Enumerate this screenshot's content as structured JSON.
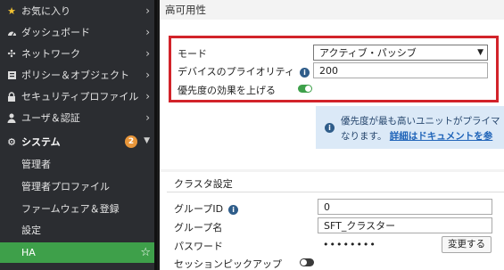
{
  "sidebar": {
    "items": [
      {
        "label": "お気に入り",
        "icon": "star-icon"
      },
      {
        "label": "ダッシュボード",
        "icon": "dashboard-icon"
      },
      {
        "label": "ネットワーク",
        "icon": "network-icon"
      },
      {
        "label": "ポリシー＆オブジェクト",
        "icon": "policy-icon"
      },
      {
        "label": "セキュリティプロファイル",
        "icon": "lock-icon"
      },
      {
        "label": "ユーザ＆認証",
        "icon": "user-icon"
      }
    ],
    "system": {
      "label": "システム",
      "badge": "2",
      "icon": "gear-icon"
    },
    "sub_items": [
      {
        "label": "管理者"
      },
      {
        "label": "管理者プロファイル"
      },
      {
        "label": "ファームウェア＆登録"
      },
      {
        "label": "設定"
      }
    ],
    "active": {
      "label": "HA"
    }
  },
  "main": {
    "section_title": "高可用性",
    "mode_label": "モード",
    "mode_value": "アクティブ・パッシブ",
    "priority_label": "デバイスのプライオリティ",
    "priority_value": "200",
    "boost_label": "優先度の効果を上げる",
    "notice_line1": "優先度が最も高いユニットがプライマ",
    "notice_line2": "なります。",
    "notice_link": "詳細はドキュメントを参",
    "cluster_title": "クラスタ設定",
    "group_id_label": "グループID",
    "group_id_value": "0",
    "group_name_label": "グループ名",
    "group_name_value": "SFT_クラスター",
    "password_label": "パスワード",
    "password_value": "••••••••",
    "change_button": "変更する",
    "session_pickup_label": "セッションピックアップ"
  },
  "colors": {
    "accent_green": "#3ea04a",
    "highlight_red": "#d2232a",
    "badge_orange": "#e8963a"
  }
}
